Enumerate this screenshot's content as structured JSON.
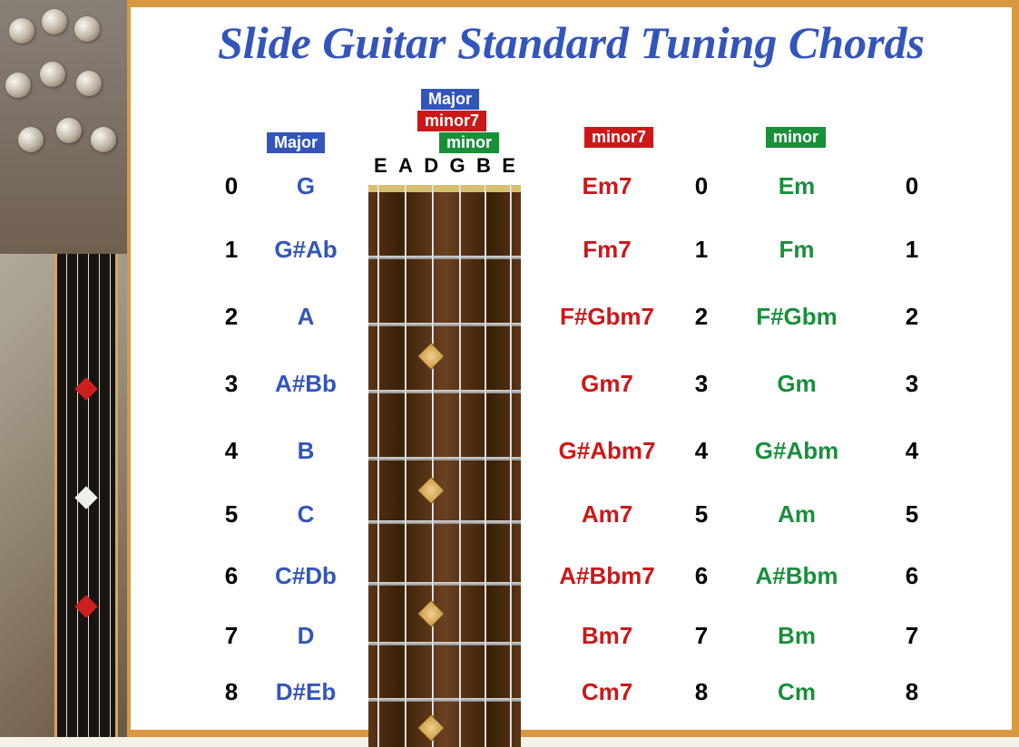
{
  "title": "Slide Guitar Standard Tuning Chords",
  "headers": {
    "major_left": "Major",
    "major_stack": "Major",
    "minor7_stack": "minor7",
    "minor_stack": "minor",
    "minor7_right": "minor7",
    "minor_far": "minor"
  },
  "strings": [
    "E",
    "A",
    "D",
    "G",
    "B",
    "E"
  ],
  "frets": [
    "0",
    "1",
    "2",
    "3",
    "4",
    "5",
    "6",
    "7",
    "8"
  ],
  "chords": {
    "major": [
      "G",
      "G#Ab",
      "A",
      "A#Bb",
      "B",
      "C",
      "C#Db",
      "D",
      "D#Eb"
    ],
    "minor7": [
      "Em7",
      "Fm7",
      "F#Gbm7",
      "Gm7",
      "G#Abm7",
      "Am7",
      "A#Bbm7",
      "Bm7",
      "Cm7"
    ],
    "minor": [
      "Em",
      "Fm",
      "F#Gbm",
      "Gm",
      "G#Abm",
      "Am",
      "A#Bbm",
      "Bm",
      "Cm"
    ]
  },
  "colors": {
    "blue": "#3355bb",
    "red": "#cc1818",
    "green": "#1a8f3a",
    "black": "#000000"
  },
  "chart_data": {
    "type": "table",
    "title": "Slide Guitar Standard Tuning Chords",
    "tuning": [
      "E",
      "A",
      "D",
      "G",
      "B",
      "E"
    ],
    "rows": [
      {
        "fret": 0,
        "major": "G",
        "minor7": "Em7",
        "minor": "Em"
      },
      {
        "fret": 1,
        "major": "G#Ab",
        "minor7": "Fm7",
        "minor": "Fm"
      },
      {
        "fret": 2,
        "major": "A",
        "minor7": "F#Gbm7",
        "minor": "F#Gbm"
      },
      {
        "fret": 3,
        "major": "A#Bb",
        "minor7": "Gm7",
        "minor": "Gm"
      },
      {
        "fret": 4,
        "major": "B",
        "minor7": "G#Abm7",
        "minor": "G#Abm"
      },
      {
        "fret": 5,
        "major": "C",
        "minor7": "Am7",
        "minor": "Am"
      },
      {
        "fret": 6,
        "major": "C#Db",
        "minor7": "A#Bbm7",
        "minor": "A#Bbm"
      },
      {
        "fret": 7,
        "major": "D",
        "minor7": "Bm7",
        "minor": "Bm"
      },
      {
        "fret": 8,
        "major": "D#Eb",
        "minor7": "Cm7",
        "minor": "Cm"
      }
    ]
  }
}
